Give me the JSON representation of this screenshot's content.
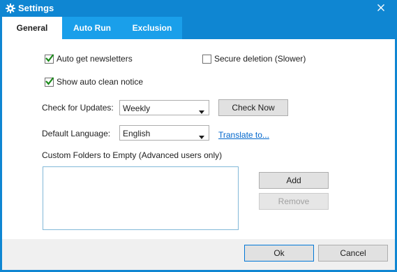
{
  "window": {
    "title": "Settings",
    "close_glyph": "✕",
    "title_icon": "gear-icon"
  },
  "tabs": [
    {
      "label": "General",
      "active": true
    },
    {
      "label": "Auto Run",
      "active": false
    },
    {
      "label": "Exclusion",
      "active": false
    }
  ],
  "general": {
    "auto_newsletters": {
      "label": "Auto get newsletters",
      "checked": true
    },
    "secure_deletion": {
      "label": "Secure deletion (Slower)",
      "checked": false
    },
    "auto_clean_notice": {
      "label": "Show auto clean notice",
      "checked": true
    },
    "updates": {
      "label": "Check for Updates:",
      "value": "Weekly",
      "button": "Check Now"
    },
    "language": {
      "label": "Default Language:",
      "value": "English",
      "link": "Translate to..."
    },
    "custom_folders": {
      "label": "Custom Folders to Empty (Advanced users only)",
      "items": [],
      "add_label": "Add",
      "remove_label": "Remove"
    }
  },
  "footer": {
    "ok_label": "Ok",
    "cancel_label": "Cancel"
  },
  "colors": {
    "titlebar": "#0f86d2",
    "tab_inactive": "#1a9fea",
    "check": "#1a8a1a",
    "link": "#0066cc"
  }
}
